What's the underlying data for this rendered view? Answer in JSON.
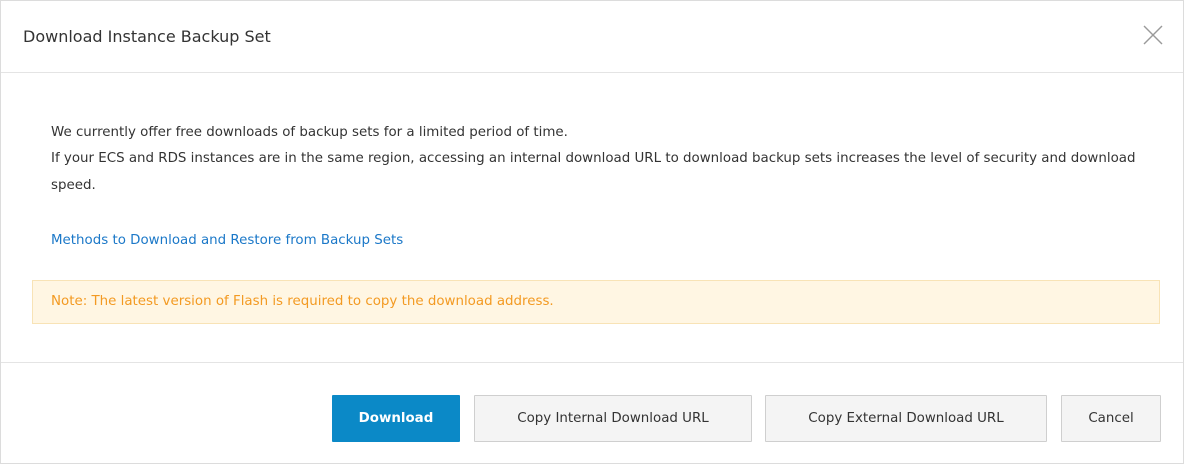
{
  "dialog": {
    "title": "Download Instance Backup Set",
    "close_icon": "close-icon"
  },
  "body": {
    "paragraph1": "We currently offer free downloads of backup sets for a limited period of time.",
    "paragraph2": "If your ECS and RDS instances are in the same region, accessing an internal download URL to download backup sets increases the level of security and download speed.",
    "link": "Methods to Download and Restore from Backup Sets",
    "note": "Note: The latest version of Flash is required to copy the download address."
  },
  "footer": {
    "download_label": "Download",
    "copy_internal_label": "Copy Internal Download URL",
    "copy_external_label": "Copy External Download URL",
    "cancel_label": "Cancel"
  },
  "colors": {
    "primary": "#0b89c7",
    "link": "#1b78c8",
    "note_text": "#f39a22",
    "note_bg": "#fff6e3"
  }
}
